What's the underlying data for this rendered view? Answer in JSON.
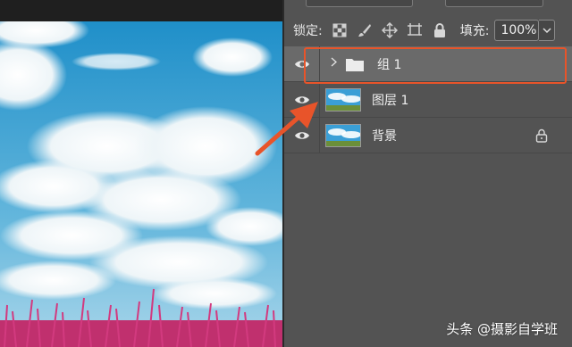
{
  "panel": {
    "lock_label": "锁定:",
    "fill_label": "填充:",
    "fill_value": "100%"
  },
  "layers": [
    {
      "name": "组 1",
      "type": "group",
      "selected": true,
      "icon": "folder-icon"
    },
    {
      "name": "图层 1",
      "type": "pixel",
      "selected": false
    },
    {
      "name": "背景",
      "type": "background",
      "selected": false,
      "locked": true
    }
  ],
  "annotation": {
    "arrow_color": "#e8542a",
    "highlight_color": "#e8542a"
  },
  "watermark": "头条 @摄影自学班"
}
